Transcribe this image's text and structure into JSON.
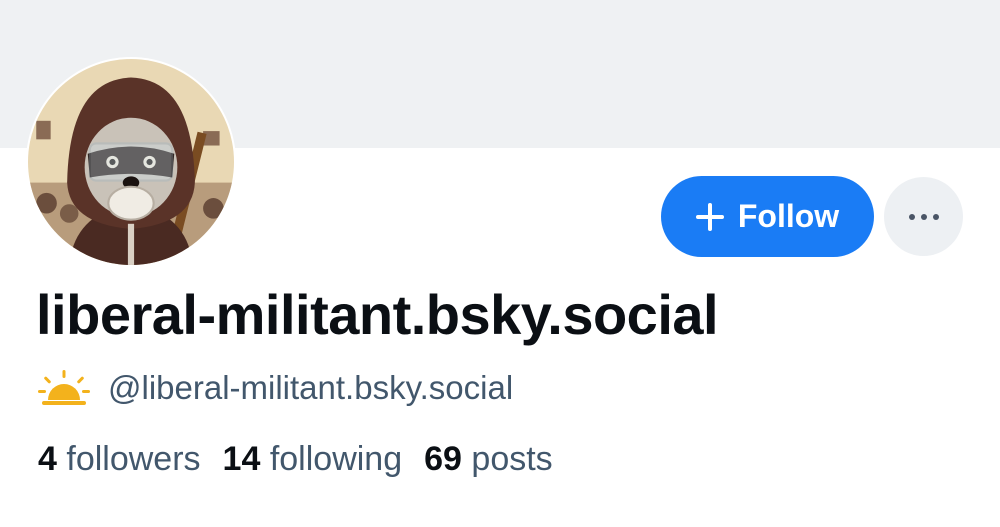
{
  "profile": {
    "display_name": "liberal-militant.bsky.social",
    "handle": "@liberal-militant.bsky.social",
    "avatar_icon": "raccoon-protester-avatar",
    "badge_icon": "sunrise-icon"
  },
  "actions": {
    "follow_label": "Follow",
    "more_icon": "ellipsis-icon"
  },
  "stats": {
    "followers_count": "4",
    "followers_label": "followers",
    "following_count": "14",
    "following_label": "following",
    "posts_count": "69",
    "posts_label": "posts"
  },
  "colors": {
    "accent": "#1a7cf5",
    "banner": "#eff1f3",
    "secondary_text": "#42576c"
  }
}
